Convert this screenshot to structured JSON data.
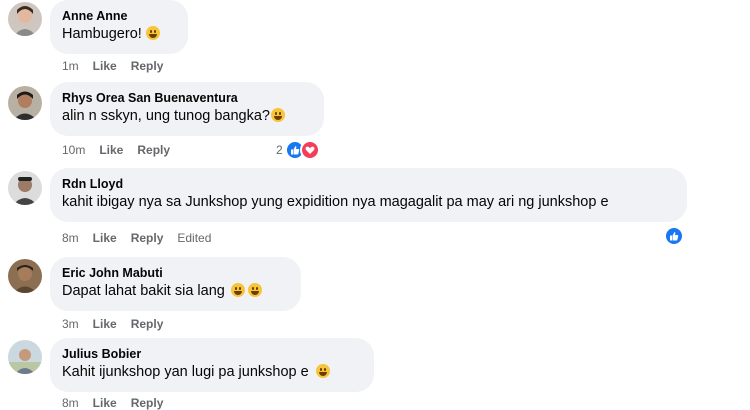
{
  "colors": {
    "bubble": "#f0f2f5",
    "meta": "#65676b",
    "like": "#1877f2",
    "love": "#f33e58"
  },
  "comments": [
    {
      "author": "Anne Anne",
      "text": "Hambugero!",
      "emoji": "laughing-emoji",
      "time": "1m",
      "like": "Like",
      "reply": "Reply"
    },
    {
      "author": "Rhys Orea San Buenaventura",
      "text": "alin n sskyn, ung tunog bangka?",
      "emoji": "laughing-emoji",
      "time": "10m",
      "like": "Like",
      "reply": "Reply",
      "reactions": {
        "count": "2",
        "icons": [
          "like-icon",
          "heart-icon"
        ]
      }
    },
    {
      "author": "Rdn Lloyd",
      "text": "kahit ibigay nya sa Junkshop yung expidition nya magagalit pa may ari ng junkshop e",
      "time": "8m",
      "like": "Like",
      "reply": "Reply",
      "edited": "Edited",
      "reactions": {
        "icons": [
          "like-icon"
        ]
      }
    },
    {
      "author": "Eric John Mabuti",
      "text": "Dapat lahat bakit sia lang",
      "emoji": "grinning-emoji",
      "emoji_count": 2,
      "time": "3m",
      "like": "Like",
      "reply": "Reply"
    },
    {
      "author": "Julius Bobier",
      "text": "Kahit ijunkshop yan lugi pa junkshop e",
      "emoji": "grinning-emoji",
      "time": "8m",
      "like": "Like",
      "reply": "Reply"
    }
  ]
}
